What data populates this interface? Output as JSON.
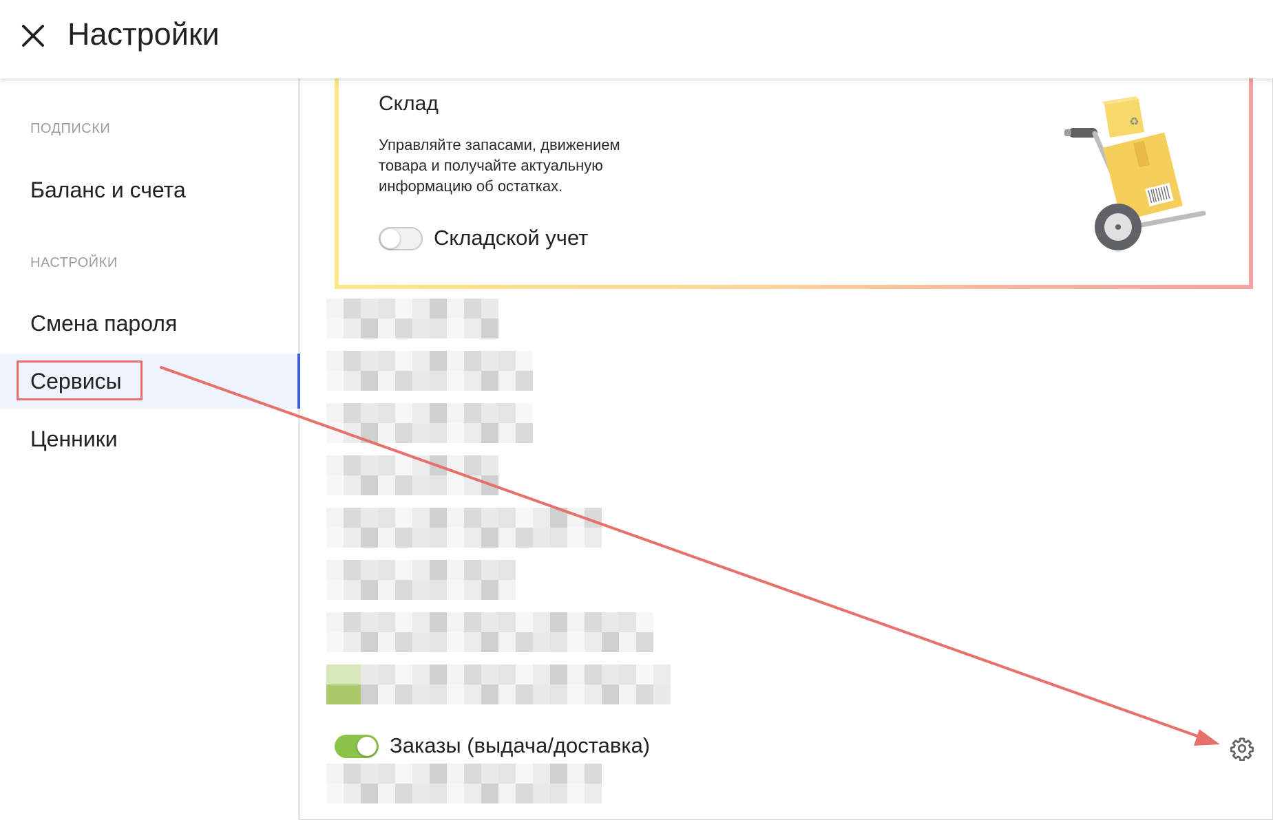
{
  "header": {
    "title": "Настройки",
    "close_icon": "close-icon"
  },
  "sidebar": {
    "section_subscriptions": "ПОДПИСКИ",
    "item_balance": "Баланс и счета",
    "section_settings": "НАСТРОЙКИ",
    "item_password": "Смена пароля",
    "item_services": "Сервисы",
    "item_tags": "Ценники",
    "active_item": "Сервисы"
  },
  "warehouse_card": {
    "title": "Склад",
    "description": "Управляйте запасами, движением товара и получайте актуальную информацию об остатках.",
    "toggle_label": "Складской учет",
    "toggle_on": false,
    "illustration": "hand-truck-boxes-illustration"
  },
  "orders": {
    "toggle_label": "Заказы (выдача/доставка)",
    "toggle_on": true,
    "settings_icon": "gear-icon"
  },
  "colors": {
    "accent": "#3f5fd4",
    "toggle_on": "#8bc34a",
    "annotation": "#e8706a",
    "active_bg": "#eff3fd"
  }
}
